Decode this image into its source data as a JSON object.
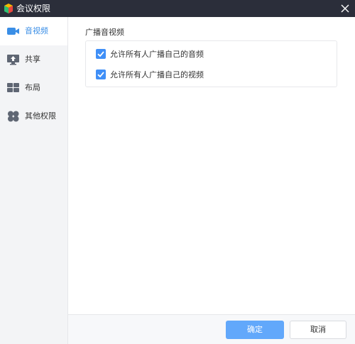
{
  "window": {
    "title": "会议权限",
    "logo_icon": "app-logo-icon",
    "close_icon": "close-icon"
  },
  "colors": {
    "accent": "#3a8ee6",
    "titlebar": "#2b2e3a",
    "primary_button": "#62a8fb",
    "checkbox": "#3f8ff7"
  },
  "sidebar": {
    "items": [
      {
        "label": "音视频",
        "icon": "video-camera-icon",
        "active": true
      },
      {
        "label": "共享",
        "icon": "screen-share-icon",
        "active": false
      },
      {
        "label": "布局",
        "icon": "grid-layout-icon",
        "active": false
      },
      {
        "label": "其他权限",
        "icon": "clover-icon",
        "active": false
      }
    ]
  },
  "main": {
    "section_title": "广播音视频",
    "options": [
      {
        "label": "允许所有人广播自己的音频",
        "checked": true
      },
      {
        "label": "允许所有人广播自己的视频",
        "checked": true
      }
    ]
  },
  "footer": {
    "ok_label": "确定",
    "cancel_label": "取消"
  }
}
